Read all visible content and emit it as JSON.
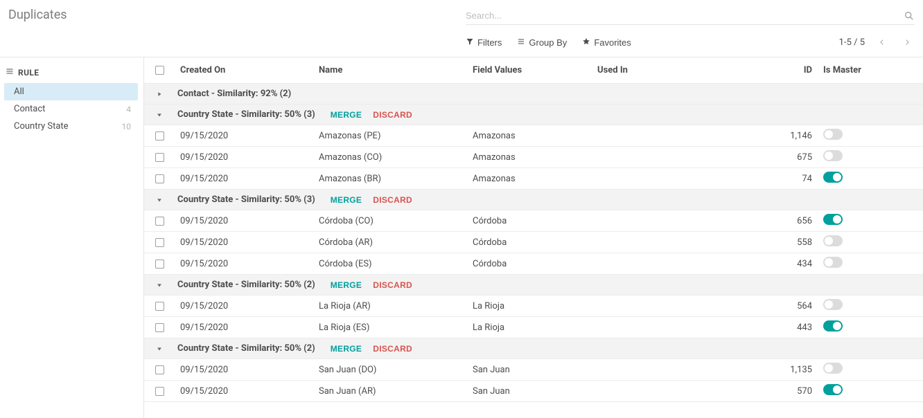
{
  "page_title": "Duplicates",
  "search": {
    "placeholder": "Search..."
  },
  "toolbar": {
    "filters": "Filters",
    "group_by": "Group By",
    "favorites": "Favorites",
    "pager": "1-5 / 5"
  },
  "sidebar": {
    "title": "RULE",
    "items": [
      {
        "label": "All",
        "count": "",
        "active": true
      },
      {
        "label": "Contact",
        "count": "4",
        "active": false
      },
      {
        "label": "Country State",
        "count": "10",
        "active": false
      }
    ]
  },
  "columns": {
    "created_on": "Created On",
    "name": "Name",
    "field_values": "Field Values",
    "used_in": "Used In",
    "id": "ID",
    "is_master": "Is Master"
  },
  "buttons": {
    "merge": "MERGE",
    "discard": "DISCARD"
  },
  "groups": [
    {
      "label": "Contact - Similarity: 92% (2)",
      "collapsed": true,
      "show_actions": false,
      "rows": []
    },
    {
      "label": "Country State - Similarity: 50% (3)",
      "collapsed": false,
      "show_actions": true,
      "rows": [
        {
          "created_on": "09/15/2020",
          "name": "Amazonas (PE)",
          "field_values": "Amazonas",
          "used_in": "",
          "id": "1,146",
          "is_master": false
        },
        {
          "created_on": "09/15/2020",
          "name": "Amazonas (CO)",
          "field_values": "Amazonas",
          "used_in": "",
          "id": "675",
          "is_master": false
        },
        {
          "created_on": "09/15/2020",
          "name": "Amazonas (BR)",
          "field_values": "Amazonas",
          "used_in": "",
          "id": "74",
          "is_master": true
        }
      ]
    },
    {
      "label": "Country State - Similarity: 50% (3)",
      "collapsed": false,
      "show_actions": true,
      "rows": [
        {
          "created_on": "09/15/2020",
          "name": "Córdoba (CO)",
          "field_values": "Córdoba",
          "used_in": "",
          "id": "656",
          "is_master": true
        },
        {
          "created_on": "09/15/2020",
          "name": "Córdoba (AR)",
          "field_values": "Córdoba",
          "used_in": "",
          "id": "558",
          "is_master": false
        },
        {
          "created_on": "09/15/2020",
          "name": "Córdoba (ES)",
          "field_values": "Córdoba",
          "used_in": "",
          "id": "434",
          "is_master": false
        }
      ]
    },
    {
      "label": "Country State - Similarity: 50% (2)",
      "collapsed": false,
      "show_actions": true,
      "rows": [
        {
          "created_on": "09/15/2020",
          "name": "La Rioja (AR)",
          "field_values": "La Rioja",
          "used_in": "",
          "id": "564",
          "is_master": false
        },
        {
          "created_on": "09/15/2020",
          "name": "La Rioja (ES)",
          "field_values": "La Rioja",
          "used_in": "",
          "id": "443",
          "is_master": true
        }
      ]
    },
    {
      "label": "Country State - Similarity: 50% (2)",
      "collapsed": false,
      "show_actions": true,
      "rows": [
        {
          "created_on": "09/15/2020",
          "name": "San Juan (DO)",
          "field_values": "San Juan",
          "used_in": "",
          "id": "1,135",
          "is_master": false
        },
        {
          "created_on": "09/15/2020",
          "name": "San Juan (AR)",
          "field_values": "San Juan",
          "used_in": "",
          "id": "570",
          "is_master": true
        }
      ]
    }
  ]
}
